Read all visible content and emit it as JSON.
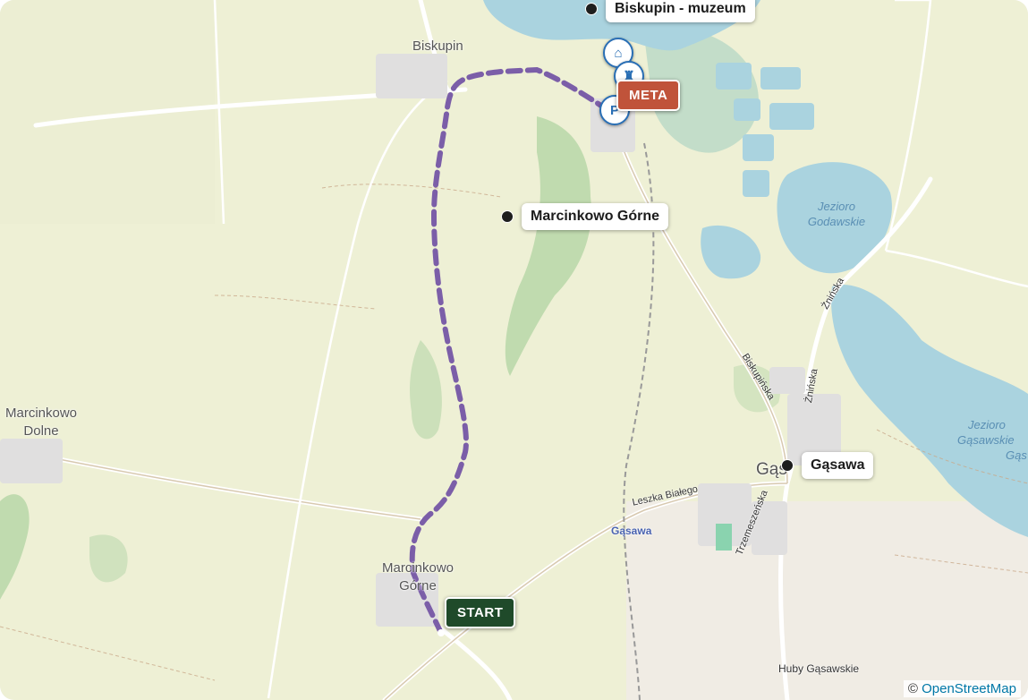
{
  "places": {
    "biskupin": "Biskupin",
    "marcinkowo_dolne_1": "Marcinkowo",
    "marcinkowo_dolne_2": "Dolne",
    "marcinkowo_gorne_1": "Marcinkowo",
    "marcinkowo_gorne_2": "Górne",
    "gasawa_map": "Gąsawa",
    "gasawa_town": "Gąs",
    "huby": "Huby Gąsawskie"
  },
  "water": {
    "godawskie_1": "Jezioro",
    "godawskie_2": "Godawskie",
    "gasawskie_1": "Jezioro",
    "gasawskie_2": "Gąsawskie",
    "gasawskie_3": "Gąs"
  },
  "roads": {
    "biskupinska": "Biskupińska",
    "zninska_1": "Żnińska",
    "zninska_2": "Żnińska",
    "leszka": "Leszka Białego",
    "trzemeszenska": "Trzemeszeńska"
  },
  "pois": [
    {
      "name": "Biskupin - muzeum"
    },
    {
      "name": "Marcinkowo Górne"
    },
    {
      "name": "Gąsawa"
    }
  ],
  "route": {
    "start_label": "START",
    "end_label": "META",
    "start_color": "#1f4a2a",
    "end_color": "#c0533a",
    "route_color": "#7b5ea8"
  },
  "markers": {
    "parking": "P"
  },
  "attribution": {
    "symbol": "©",
    "link": "OpenStreetMap"
  },
  "colors": {
    "land": "#f2efe9",
    "farmland": "#eef0d5",
    "water": "#aad3df",
    "wetland": "#b8d8c5",
    "forest": "#add19e"
  }
}
